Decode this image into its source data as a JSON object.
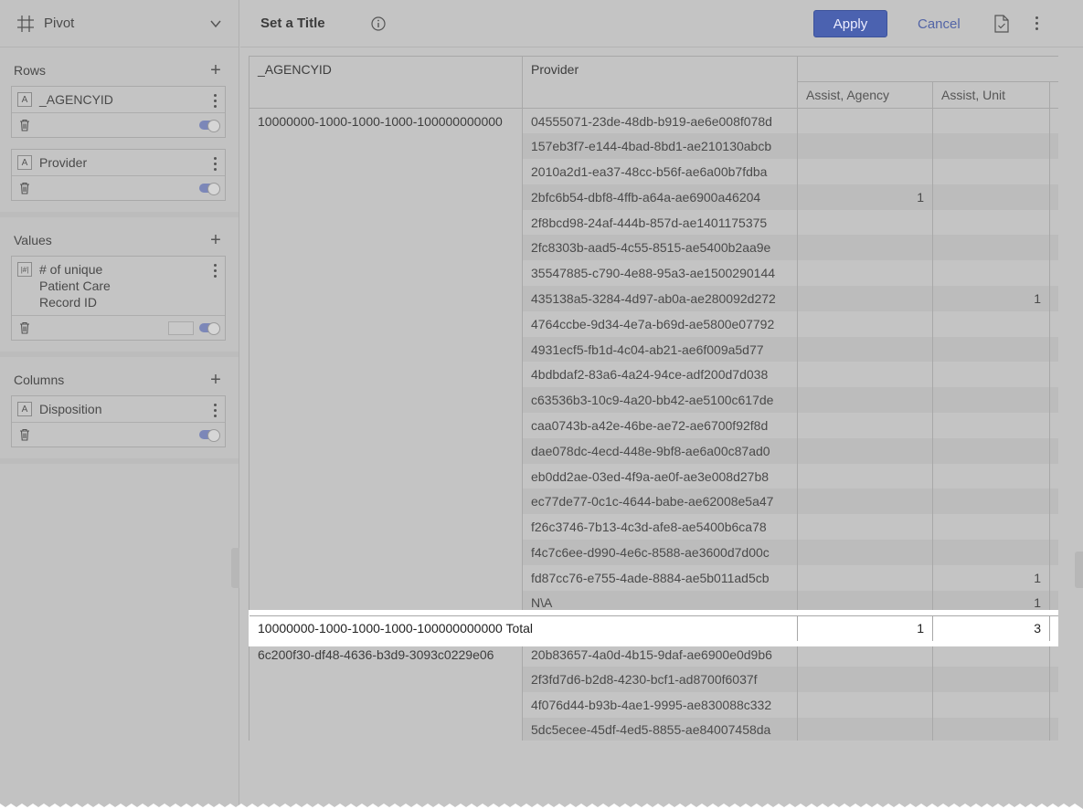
{
  "sidebar": {
    "title": "Pivot",
    "sections": {
      "rows": {
        "label": "Rows",
        "fields": [
          "_AGENCYID",
          "Provider"
        ]
      },
      "values": {
        "label": "Values",
        "field_lines": [
          "# of unique",
          "Patient Care",
          "Record ID"
        ]
      },
      "columns": {
        "label": "Columns",
        "fields": [
          "Disposition"
        ]
      }
    },
    "text_badge": "A",
    "num_badge": "|#|"
  },
  "toolbar": {
    "title": "Set a Title",
    "apply_label": "Apply",
    "cancel_label": "Cancel"
  },
  "table": {
    "headers": {
      "agency": "_AGENCYID",
      "provider": "Provider"
    },
    "column_values": [
      "Assist, Agency",
      "Assist, Unit"
    ],
    "groups": [
      {
        "agency": "10000000-1000-1000-1000-100000000000",
        "rows": [
          {
            "provider": "04555071-23de-48db-b919-ae6e008f078d",
            "v": [
              "",
              ""
            ]
          },
          {
            "provider": "157eb3f7-e144-4bad-8bd1-ae210130abcb",
            "v": [
              "",
              ""
            ]
          },
          {
            "provider": "2010a2d1-ea37-48cc-b56f-ae6a00b7fdba",
            "v": [
              "",
              ""
            ]
          },
          {
            "provider": "2bfc6b54-dbf8-4ffb-a64a-ae6900a46204",
            "v": [
              "1",
              ""
            ]
          },
          {
            "provider": "2f8bcd98-24af-444b-857d-ae1401175375",
            "v": [
              "",
              ""
            ]
          },
          {
            "provider": "2fc8303b-aad5-4c55-8515-ae5400b2aa9e",
            "v": [
              "",
              ""
            ]
          },
          {
            "provider": "35547885-c790-4e88-95a3-ae1500290144",
            "v": [
              "",
              ""
            ]
          },
          {
            "provider": "435138a5-3284-4d97-ab0a-ae280092d272",
            "v": [
              "",
              "1"
            ]
          },
          {
            "provider": "4764ccbe-9d34-4e7a-b69d-ae5800e07792",
            "v": [
              "",
              ""
            ]
          },
          {
            "provider": "4931ecf5-fb1d-4c04-ab21-ae6f009a5d77",
            "v": [
              "",
              ""
            ]
          },
          {
            "provider": "4bdbdaf2-83a6-4a24-94ce-adf200d7d038",
            "v": [
              "",
              ""
            ]
          },
          {
            "provider": "c63536b3-10c9-4a20-bb42-ae5100c617de",
            "v": [
              "",
              ""
            ]
          },
          {
            "provider": "caa0743b-a42e-46be-ae72-ae6700f92f8d",
            "v": [
              "",
              ""
            ]
          },
          {
            "provider": "dae078dc-4ecd-448e-9bf8-ae6a00c87ad0",
            "v": [
              "",
              ""
            ]
          },
          {
            "provider": "eb0dd2ae-03ed-4f9a-ae0f-ae3e008d27b8",
            "v": [
              "",
              ""
            ]
          },
          {
            "provider": "ec77de77-0c1c-4644-babe-ae62008e5a47",
            "v": [
              "",
              ""
            ]
          },
          {
            "provider": "f26c3746-7b13-4c3d-afe8-ae5400b6ca78",
            "v": [
              "",
              ""
            ]
          },
          {
            "provider": "f4c7c6ee-d990-4e6c-8588-ae3600d7d00c",
            "v": [
              "",
              ""
            ]
          },
          {
            "provider": "fd87cc76-e755-4ade-8884-ae5b011ad5cb",
            "v": [
              "",
              "1"
            ]
          },
          {
            "provider": "N\\A",
            "v": [
              "",
              "1"
            ]
          }
        ],
        "total_label": "10000000-1000-1000-1000-100000000000 Total",
        "total_values": [
          "1",
          "3"
        ]
      },
      {
        "agency": "6c200f30-df48-4636-b3d9-3093c0229e06",
        "rows": [
          {
            "provider": "20b83657-4a0d-4b15-9daf-ae6900e0d9b6",
            "v": [
              "",
              ""
            ]
          },
          {
            "provider": "2f3fd7d6-b2d8-4230-bcf1-ad8700f6037f",
            "v": [
              "",
              ""
            ]
          },
          {
            "provider": "4f076d44-b93b-4ae1-9995-ae830088c332",
            "v": [
              "",
              ""
            ]
          },
          {
            "provider": "5dc5ecee-45df-4ed5-8855-ae84007458da",
            "v": [
              "",
              ""
            ]
          }
        ]
      }
    ]
  }
}
